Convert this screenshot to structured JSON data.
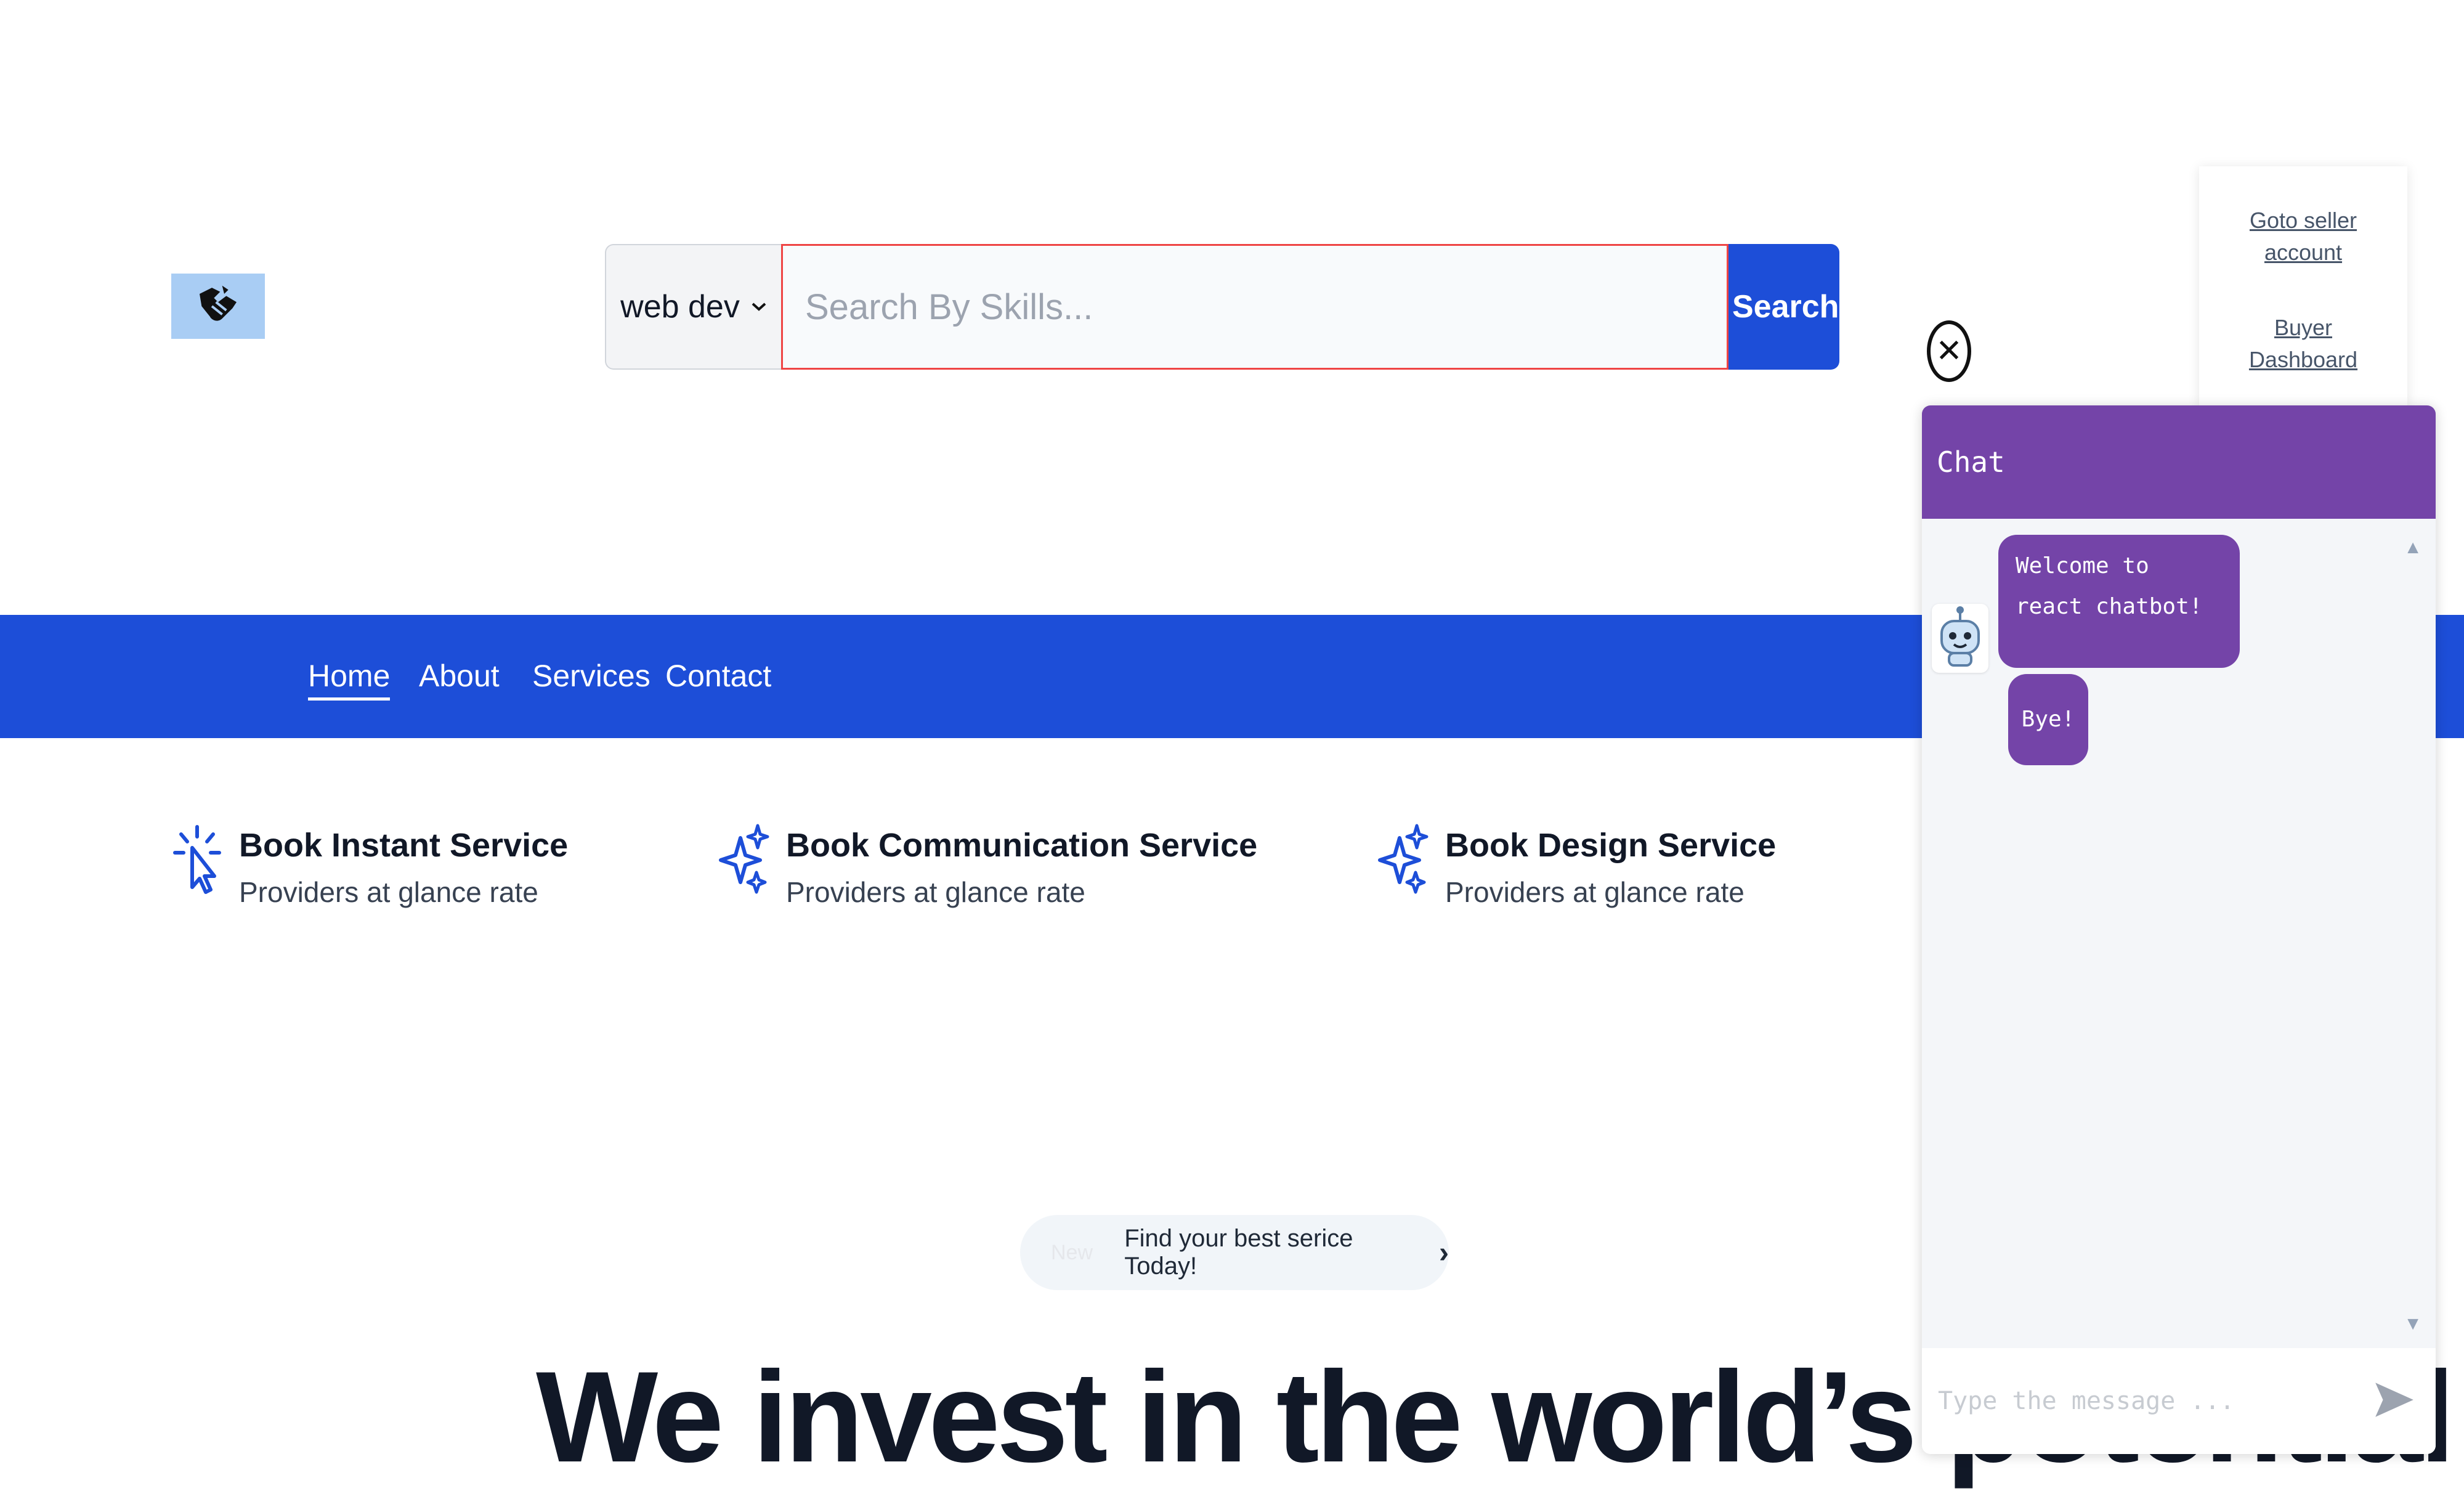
{
  "header": {
    "logo_icon": "handshake-icon",
    "category_select": {
      "value": "web dev"
    },
    "search": {
      "placeholder": "Search By Skills...",
      "button_label": "Search"
    }
  },
  "account_menu": {
    "seller_link": "Goto seller account",
    "buyer_link": "Buyer Dashboard"
  },
  "nav": {
    "items": [
      {
        "label": "Home",
        "active": true
      },
      {
        "label": "About"
      },
      {
        "label": "Services"
      },
      {
        "label": "Contact"
      }
    ]
  },
  "features": [
    {
      "icon": "cursor-click-icon",
      "title": "Book Instant Service",
      "subtitle": "Providers at glance rate"
    },
    {
      "icon": "sparkles-icon",
      "title": "Book Communication Service",
      "subtitle": "Providers at glance rate"
    },
    {
      "icon": "sparkles-icon",
      "title": "Book Design Service",
      "subtitle": "Providers at glance rate"
    }
  ],
  "announcement": {
    "badge": "New",
    "text": "Find your best serice Today!",
    "chevron_icon": "chevron-right-icon"
  },
  "hero": {
    "heading": "We invest in the world’s potential"
  },
  "chat": {
    "close_icon": "close-icon",
    "header_title": "Chat",
    "bot_avatar": "robot-icon",
    "messages": [
      {
        "from": "bot",
        "text": "Welcome to react chatbot!"
      },
      {
        "from": "bot",
        "text": "Bye!"
      }
    ],
    "input_placeholder": "Type the message ...",
    "send_icon": "send-icon"
  },
  "colors": {
    "primary_blue": "#1d4ed8",
    "chat_purple": "#7444a8",
    "logo_bg": "#a9cdf4",
    "search_border": "#ef4444"
  }
}
